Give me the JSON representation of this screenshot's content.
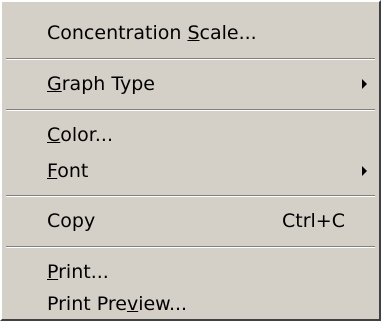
{
  "menu": {
    "items": [
      {
        "pre": "Concentration ",
        "mnemonic": "S",
        "post": "cale..."
      },
      {
        "pre": "",
        "mnemonic": "G",
        "post": "raph Type",
        "submenu": true
      },
      {
        "pre": "",
        "mnemonic": "C",
        "post": "olor..."
      },
      {
        "pre": "",
        "mnemonic": "F",
        "post": "ont",
        "submenu": true
      },
      {
        "pre": "Copy",
        "mnemonic": "",
        "post": "",
        "shortcut": "Ctrl+C"
      },
      {
        "pre": "",
        "mnemonic": "P",
        "post": "rint..."
      },
      {
        "pre": "Print Pre",
        "mnemonic": "v",
        "post": "iew..."
      }
    ]
  },
  "icons": {
    "submenu": "triangle-right-icon"
  },
  "colors": {
    "menu_background": "#d4d0c8",
    "separator_shadow": "#808080",
    "separator_highlight": "#ffffff",
    "text": "#000000"
  }
}
